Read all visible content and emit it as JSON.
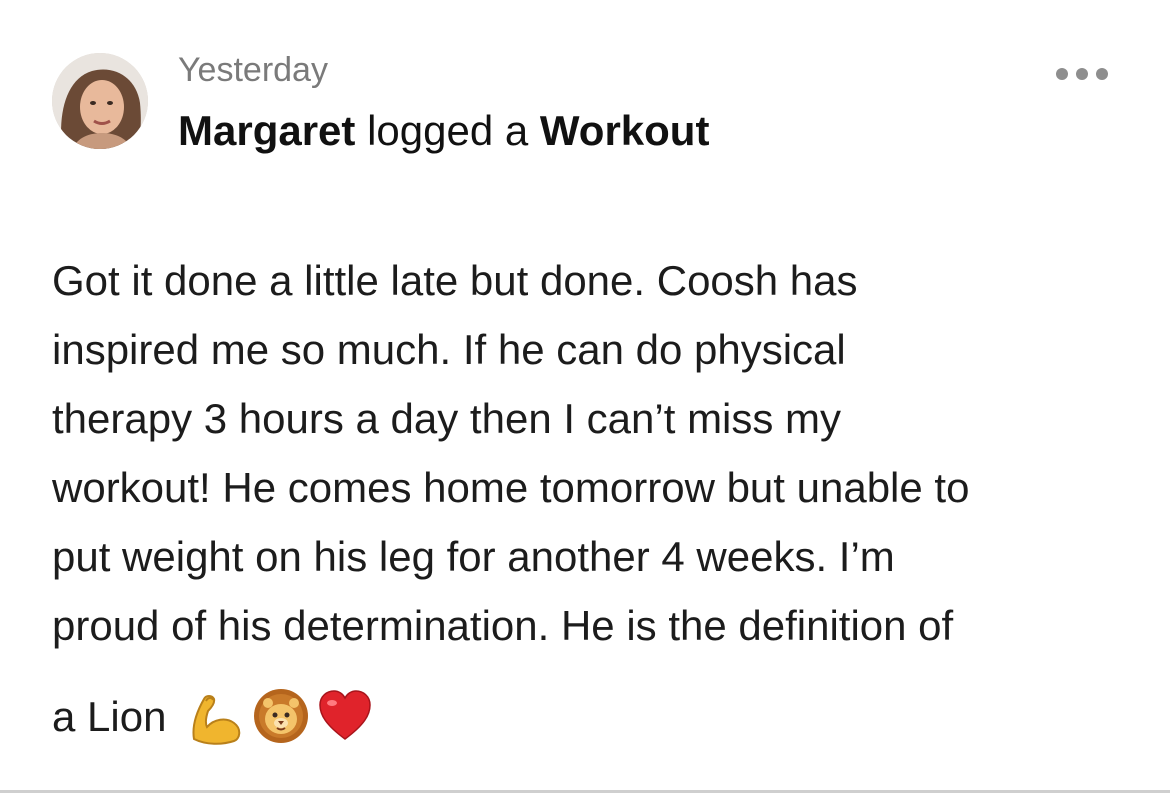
{
  "post": {
    "timestamp": "Yesterday",
    "author": "Margaret",
    "action": "logged a",
    "activity": "Workout",
    "avatar_icon": "user-avatar-photo",
    "more_icon": "more-horizontal-icon",
    "body_lines": [
      "Got it done a little late but done. Coosh has",
      "inspired me so much. If he can do physical",
      "therapy 3 hours a day then I can’t miss my",
      "workout! He comes home tomorrow but unable to",
      "put weight on his leg for another 4 weeks. I’m",
      "proud of his determination. He is the definition of"
    ],
    "last_line_text": "a Lion",
    "emojis": [
      "flexed-biceps-emoji",
      "lion-face-emoji",
      "red-heart-emoji"
    ]
  },
  "colors": {
    "text": "#1c1c1c",
    "muted": "#7a7a7a",
    "icon": "#8e8e8e",
    "divider": "#cfcfcf"
  }
}
